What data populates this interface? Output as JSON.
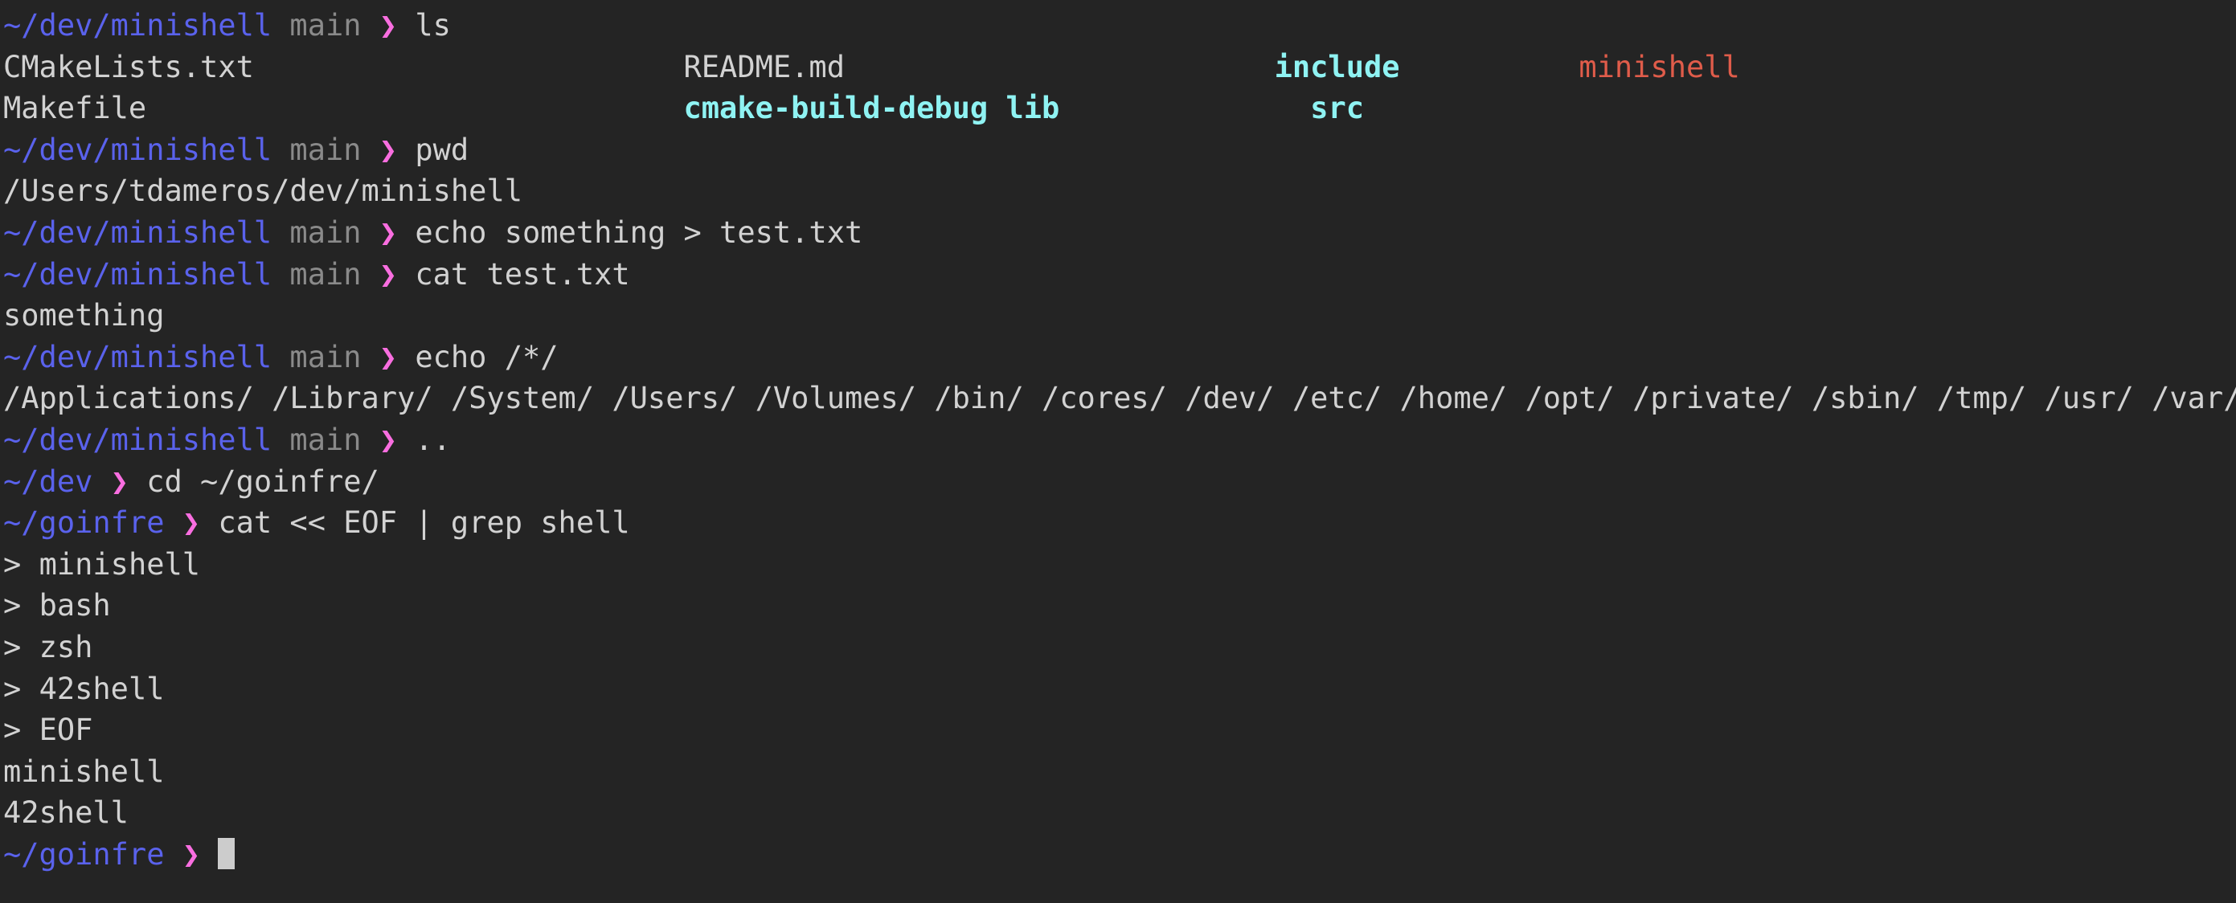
{
  "terminal": {
    "app": "terminal-emulator",
    "colors": {
      "background": "#242424",
      "foreground": "#d2d2d2",
      "prompt_path": "#5a62ec",
      "prompt_branch": "#8a8a8a",
      "prompt_arrow": "#f96ee0",
      "directory": "#8ff3f3",
      "executable": "#e05c4a",
      "cursor": "#cccccc"
    },
    "symbols": {
      "arrow": "❯",
      "heredoc_prompt": ">"
    },
    "lines": [
      {
        "type": "prompt",
        "path": "~/dev/minishell",
        "branch": "main",
        "command": "ls"
      },
      {
        "type": "ls",
        "entries": [
          {
            "text": "CMakeLists.txt",
            "kind": "file",
            "pad": 24
          },
          {
            "text": "README.md",
            "kind": "file",
            "pad": 24
          },
          {
            "text": "include",
            "kind": "dir",
            "pad": 10
          },
          {
            "text": "minishell",
            "kind": "exec",
            "pad": 0
          }
        ]
      },
      {
        "type": "ls",
        "entries": [
          {
            "text": "Makefile",
            "kind": "file",
            "pad": 30
          },
          {
            "text": "cmake-build-debug",
            "kind": "dir",
            "pad": 1
          },
          {
            "text": "lib",
            "kind": "dir",
            "pad": 14
          },
          {
            "text": "src",
            "kind": "dir",
            "pad": 0
          }
        ]
      },
      {
        "type": "prompt",
        "path": "~/dev/minishell",
        "branch": "main",
        "command": "pwd"
      },
      {
        "type": "output",
        "text": "/Users/tdameros/dev/minishell"
      },
      {
        "type": "prompt",
        "path": "~/dev/minishell",
        "branch": "main",
        "command": "echo something > test.txt"
      },
      {
        "type": "prompt",
        "path": "~/dev/minishell",
        "branch": "main",
        "command": "cat test.txt"
      },
      {
        "type": "output",
        "text": "something"
      },
      {
        "type": "prompt",
        "path": "~/dev/minishell",
        "branch": "main",
        "command": "echo /*/"
      },
      {
        "type": "output",
        "text": "/Applications/ /Library/ /System/ /Users/ /Volumes/ /bin/ /cores/ /dev/ /etc/ /home/ /opt/ /private/ /sbin/ /tmp/ /usr/ /var/"
      },
      {
        "type": "prompt",
        "path": "~/dev/minishell",
        "branch": "main",
        "command": ".."
      },
      {
        "type": "prompt",
        "path": "~/dev",
        "branch": "",
        "command": "cd ~/goinfre/"
      },
      {
        "type": "prompt",
        "path": "~/goinfre",
        "branch": "",
        "command": "cat << EOF | grep shell"
      },
      {
        "type": "heredoc",
        "text": "minishell"
      },
      {
        "type": "heredoc",
        "text": "bash"
      },
      {
        "type": "heredoc",
        "text": "zsh"
      },
      {
        "type": "heredoc",
        "text": "42shell"
      },
      {
        "type": "heredoc",
        "text": "EOF"
      },
      {
        "type": "output",
        "text": "minishell"
      },
      {
        "type": "output",
        "text": "42shell"
      },
      {
        "type": "prompt",
        "path": "~/goinfre",
        "branch": "",
        "command": "",
        "cursor": true
      }
    ]
  }
}
